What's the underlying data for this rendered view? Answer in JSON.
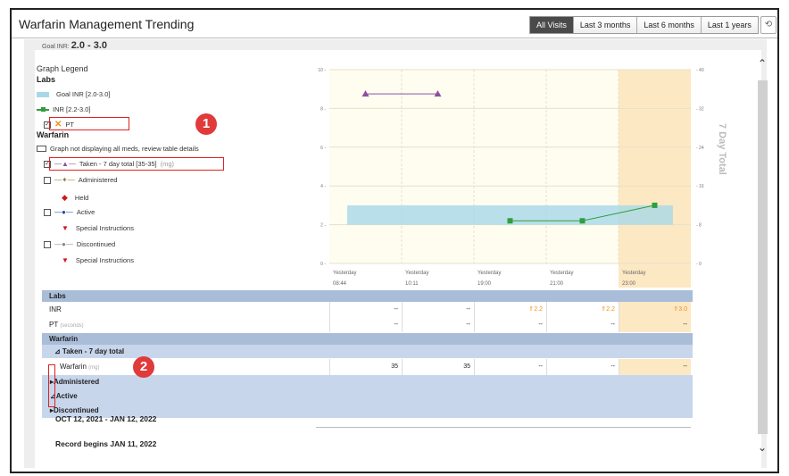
{
  "header": {
    "title": "Warfarin Management Trending",
    "filters": [
      "All Visits",
      "Last 3 months",
      "Last 6 months",
      "Last 1 years"
    ],
    "active_filter": "All Visits",
    "refresh_icon": "refresh-icon"
  },
  "top_clip": {
    "label": "Goal INR:",
    "value": "2.0 - 3.0"
  },
  "legend": {
    "title": "Graph Legend",
    "labs_heading": "Labs",
    "goal_inr": "Goal INR  [2.0-3.0]",
    "inr": "INR  [2.2-3.0]",
    "pt": "PT",
    "warfarin_heading": "Warfarin",
    "not_displaying": "Graph not displaying all meds, review table details",
    "taken": "Taken - 7 day total  [35-35]",
    "taken_unit": "(mg)",
    "administered": "Administered",
    "held": "Held",
    "active": "Active",
    "special1": "Special Instructions",
    "discontinued": "Discontinued",
    "special2": "Special Instructions"
  },
  "badges": {
    "one": "1",
    "two": "2"
  },
  "chart_data": {
    "type": "line",
    "title": "",
    "y2label": "7 Day Total",
    "ylim_left": [
      0,
      10
    ],
    "ylim_right": [
      0,
      40
    ],
    "left_ticks": [
      "10",
      "8",
      "6",
      "4",
      "2",
      "0"
    ],
    "right_ticks": [
      "40",
      "32",
      "24",
      "16",
      "8",
      "0"
    ],
    "categories": [
      {
        "day": "Yesterday",
        "time": "08:44"
      },
      {
        "day": "Yesterday",
        "time": "10:11"
      },
      {
        "day": "Yesterday",
        "time": "19:00"
      },
      {
        "day": "Yesterday",
        "time": "21:00"
      },
      {
        "day": "Yesterday",
        "time": "23:00"
      }
    ],
    "goal_band": [
      2.0,
      3.0
    ],
    "series": [
      {
        "name": "INR",
        "color": "#2e9e3e",
        "points": [
          [
            2,
            2.2
          ],
          [
            3,
            2.2
          ],
          [
            4,
            3.0
          ]
        ]
      },
      {
        "name": "Taken - 7 day total",
        "color": "#8e4fa0",
        "axis": "right",
        "points": [
          [
            0,
            35
          ],
          [
            1,
            35
          ]
        ]
      }
    ],
    "highlight_color": "#fde8c4"
  },
  "table": {
    "labs_heading": "Labs",
    "inr_label": "INR",
    "pt_label": "PT",
    "pt_unit": "(seconds)",
    "inr_values": [
      "--",
      "--",
      "2.2",
      "2.2",
      "3.0"
    ],
    "pt_values": [
      "--",
      "--",
      "--",
      "--",
      "--"
    ],
    "warfarin_heading": "Warfarin",
    "taken_group": "⊿ Taken - 7 day total",
    "warfarin_label": "Warfarin",
    "warfarin_unit": "(mg)",
    "warfarin_values": [
      "35",
      "35",
      "--",
      "--",
      "--"
    ],
    "administered": "Administered",
    "active": "Active",
    "discontinued": "Discontinued",
    "date_range": "OCT 12, 2021 - JAN 12, 2022",
    "record_begins": "Record begins JAN 11, 2022"
  }
}
